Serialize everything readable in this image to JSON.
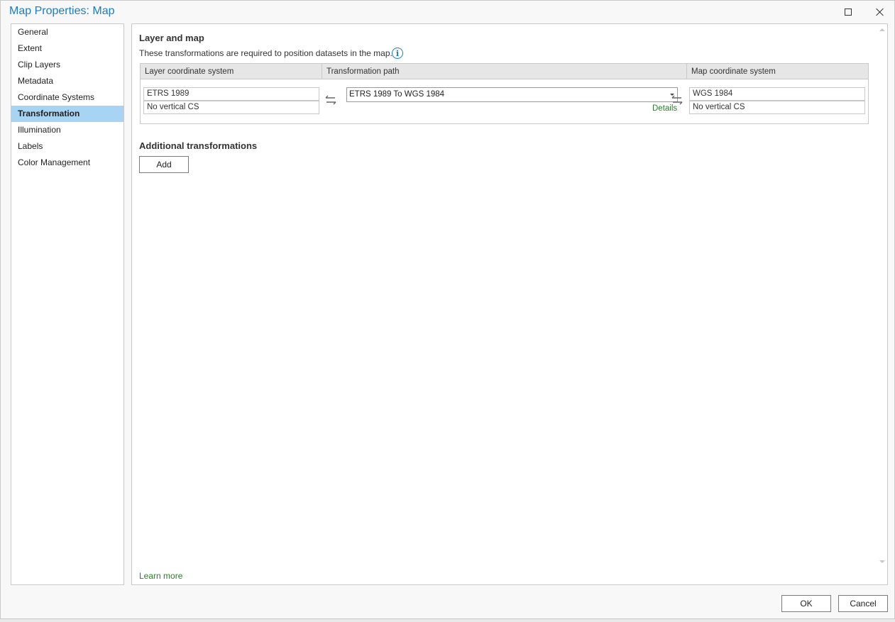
{
  "window": {
    "title": "Map Properties: Map"
  },
  "sidebar": {
    "items": [
      {
        "label": "General"
      },
      {
        "label": "Extent"
      },
      {
        "label": "Clip Layers"
      },
      {
        "label": "Metadata"
      },
      {
        "label": "Coordinate Systems"
      },
      {
        "label": "Transformation",
        "active": true
      },
      {
        "label": "Illumination"
      },
      {
        "label": "Labels"
      },
      {
        "label": "Color Management"
      }
    ]
  },
  "main": {
    "layer_and_map": {
      "title": "Layer and map",
      "description": "These transformations are required to position datasets in the map.",
      "info_icon": "info-icon",
      "columns": {
        "layer_cs": "Layer coordinate system",
        "transformation_path": "Transformation path",
        "map_cs": "Map coordinate system"
      },
      "layer_cs": {
        "horizontal": "ETRS 1989",
        "vertical": "No vertical CS"
      },
      "transformation": {
        "selected": "ETRS 1989 To WGS 1984",
        "details_label": "Details"
      },
      "map_cs": {
        "horizontal": "WGS 1984",
        "vertical": "No vertical CS"
      }
    },
    "additional": {
      "title": "Additional transformations",
      "add_label": "Add"
    },
    "learn_more": "Learn more"
  },
  "footer": {
    "ok_label": "OK",
    "cancel_label": "Cancel"
  },
  "colors": {
    "accent": "#1a7dc1",
    "link": "#2d7a2d",
    "selected_bg": "#a6d4f2"
  }
}
